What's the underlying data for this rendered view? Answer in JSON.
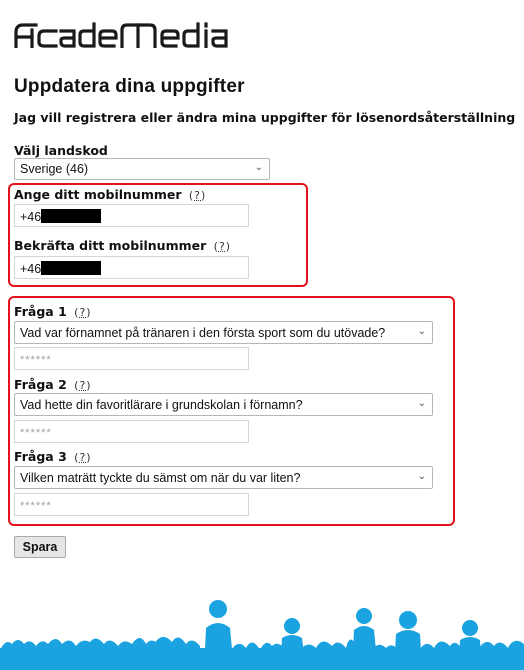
{
  "brand": {
    "logo_text": "AcadeMedia"
  },
  "page": {
    "title": "Uppdatera dina uppgifter",
    "subtitle": "Jag vill registrera eller ändra mina uppgifter för lösenordsåterställning"
  },
  "country": {
    "label": "Välj landskod",
    "selected": "Sverige (46)"
  },
  "phone": {
    "label": "Ange ditt mobilnummer",
    "help": "?",
    "prefix": "+46",
    "confirm_label": "Bekräfta ditt mobilnummer",
    "confirm_help": "?",
    "confirm_prefix": "+46"
  },
  "questions": [
    {
      "label": "Fråga 1",
      "help": "?",
      "selected": "Vad var förnamnet på tränaren i den första sport som du utövade?",
      "answer_placeholder": "******"
    },
    {
      "label": "Fråga 2",
      "help": "?",
      "selected": "Vad hette din favoritlärare i grundskolan i förnamn?",
      "answer_placeholder": "******"
    },
    {
      "label": "Fråga 3",
      "help": "?",
      "selected": "Vilken maträtt tyckte du sämst om när du var liten?",
      "answer_placeholder": "******"
    }
  ],
  "actions": {
    "save_label": "Spara"
  },
  "colors": {
    "highlight": "#e3131b",
    "crowd": "#1aa3e0",
    "logo": "#1a1a1a"
  },
  "icons": {
    "dropdown": "chevron-down-icon",
    "help": "question-icon"
  }
}
